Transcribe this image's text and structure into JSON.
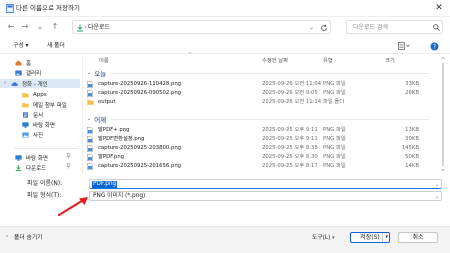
{
  "window": {
    "title": "다른 이름으로 저장하기",
    "close_glyph": "✕"
  },
  "nav": {
    "back": "←",
    "forward": "→",
    "up_chevron": "⌄",
    "up": "↑",
    "address": "다운로드",
    "address_chevron": "›",
    "search_placeholder": "다운로드 검색",
    "accent": "#0b63d4"
  },
  "toolbar": {
    "organize": "구성 ▾",
    "new_folder": "새 폴더"
  },
  "sidebar": {
    "items": [
      {
        "label": "홈",
        "icon": "home-icon",
        "color": "#e07a2f"
      },
      {
        "label": "갤러리",
        "icon": "gallery-icon",
        "color": "#3a7bd5"
      },
      {
        "label": "정화 - 개인",
        "icon": "cloud-icon",
        "color": "#3a7bd5",
        "selected": true
      },
      {
        "label": "Apps",
        "icon": "folder-icon",
        "color": "#f2c14e"
      },
      {
        "label": "메일 첨부 파일",
        "icon": "folder-icon",
        "color": "#f2c14e"
      },
      {
        "label": "문서",
        "icon": "document-icon",
        "color": "#4a7cc9"
      },
      {
        "label": "바탕 화면",
        "icon": "desktop-icon",
        "color": "#2f7fd1"
      },
      {
        "label": "사진",
        "icon": "picture-icon",
        "color": "#5a9bd5"
      },
      {
        "label": "바탕 화면",
        "icon": "desktop-icon",
        "color": "#2f7fd1"
      },
      {
        "label": "다운로드",
        "icon": "download-icon",
        "color": "#2a9d5c"
      }
    ]
  },
  "columns": {
    "name": "이름",
    "date": "수정한 날짜",
    "type": "유형",
    "size": "크기",
    "sort_glyph": "⌃"
  },
  "groups": [
    {
      "label": "오늘",
      "files": [
        {
          "name": "capture-20250926-110428.png",
          "date": "2025-09-26 오전 11:04",
          "type": "PNG 파일",
          "size": "33KB",
          "icon": "image-file-icon"
        },
        {
          "name": "capture-20250926-090502.png",
          "date": "2025-09-26 오전 9:05",
          "type": "PNG 파일",
          "size": "26KB",
          "icon": "image-file-icon"
        },
        {
          "name": "output",
          "date": "2025-09-26 오전 11:14",
          "type": "파일 폴더",
          "size": "",
          "icon": "folder-icon"
        }
      ]
    },
    {
      "label": "어제",
      "files": [
        {
          "name": "말PDF+.png",
          "date": "2025-09-25 오후 9:11",
          "type": "PNG 파일",
          "size": "13KB",
          "icon": "image-file-icon"
        },
        {
          "name": "말PDF변환설정.png",
          "date": "2025-09-25 오후 9:11",
          "type": "PNG 파일",
          "size": "30KB",
          "icon": "image-file-icon"
        },
        {
          "name": "capture-20250925-203800.png",
          "date": "2025-09-25 오후 8:38",
          "type": "PNG 파일",
          "size": "145KB",
          "icon": "image-file-icon"
        },
        {
          "name": "말PDF.png",
          "date": "2025-09-25 오후 8:30",
          "type": "PNG 파일",
          "size": "50KB",
          "icon": "image-file-icon"
        },
        {
          "name": "capture-20250925-201656.png",
          "date": "2025-09-25 오후 8:17",
          "type": "PNG 파일",
          "size": "14KB",
          "icon": "image-file-icon"
        }
      ]
    }
  ],
  "form": {
    "filename_label": "파일 이름(N):",
    "filename_value": "PDF.png",
    "filetype_label": "파일 형식(T):",
    "filetype_value": "PNG 이미지 (*.png)",
    "chevron": "⌄"
  },
  "footer": {
    "hide_folders": "폴더 숨기기",
    "hide_chevron": "⌃",
    "tools": "도구(L)",
    "tools_chevron": "▾",
    "save": "저장(S)",
    "save_chevron": "▾",
    "cancel": "취소"
  },
  "annotation": {
    "arrow_color": "#e0201f"
  }
}
